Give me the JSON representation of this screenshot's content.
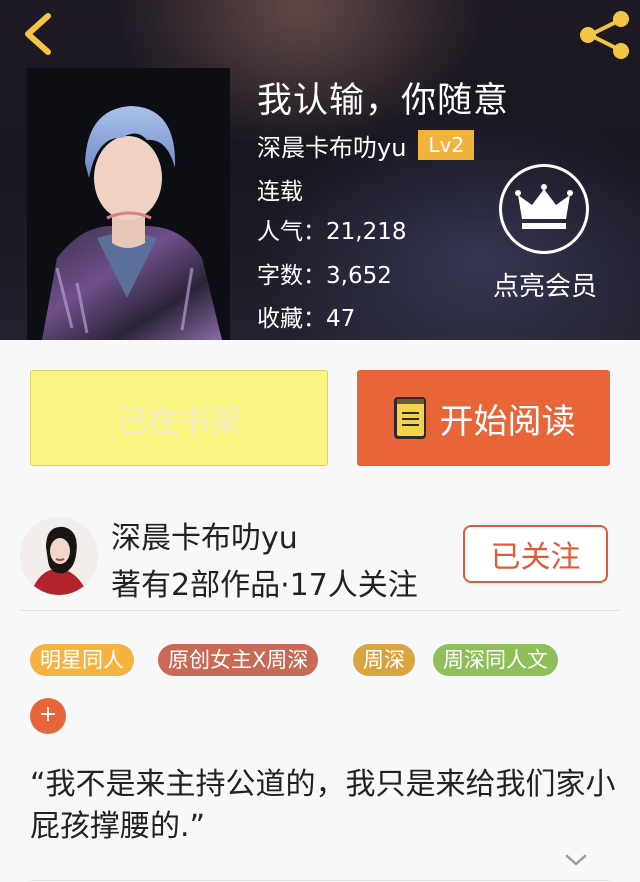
{
  "header": {
    "back_icon": "chevron-left-icon",
    "share_icon": "share-icon"
  },
  "book": {
    "title": "我认输，你随意",
    "author": "深晨卡布叻yu",
    "level": "Lv2",
    "status": "连载",
    "popularity_label": "人气：",
    "popularity": "21,218",
    "word_count_label": "字数：",
    "word_count": "3,652",
    "favorites_label": "收藏：",
    "favorites": "47"
  },
  "vip": {
    "icon": "crown-icon",
    "label": "点亮会员"
  },
  "actions": {
    "shelf_label": "已在书架",
    "read_label": "开始阅读",
    "read_icon": "book-icon"
  },
  "author_card": {
    "name": "深晨卡布叻yu",
    "stats": "著有2部作品·17人关注",
    "follow_label": "已关注"
  },
  "tags": [
    {
      "label": "明星同人",
      "color": "#f5b342"
    },
    {
      "label": "原创女主X周深",
      "color": "#c86a56"
    },
    {
      "label": "周深",
      "color": "#d9a43f"
    },
    {
      "label": "周深同人文",
      "color": "#8fbf5a"
    }
  ],
  "add_tag_label": "+",
  "quote": "“我不是来主持公道的，我只是来给我们家小屁孩撑腰的.”",
  "colors": {
    "accent": "#e8653a",
    "level_badge": "#f2b33c",
    "shelf_button": "#fbf681"
  }
}
